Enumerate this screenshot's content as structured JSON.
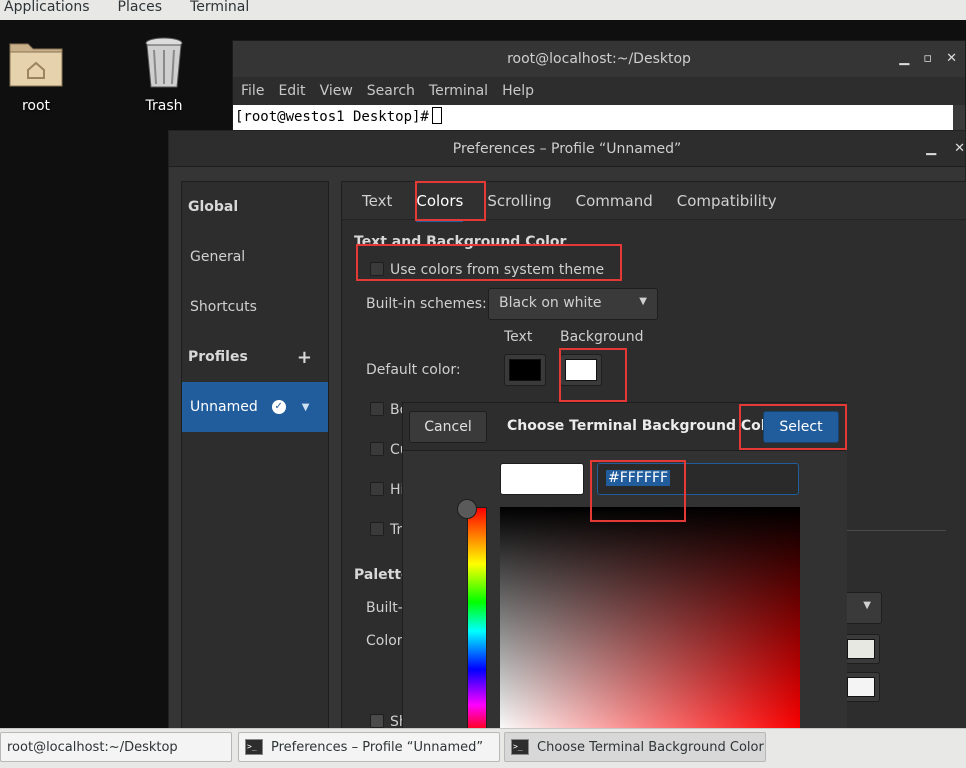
{
  "top_panel": {
    "menus": [
      "Applications",
      "Places",
      "Terminal"
    ]
  },
  "desktop": {
    "icons": [
      {
        "label": "root",
        "icon": "home-folder-icon"
      },
      {
        "label": "Trash",
        "icon": "trash-icon"
      }
    ]
  },
  "terminal": {
    "title": "root@localhost:~/Desktop",
    "menu": [
      "File",
      "Edit",
      "View",
      "Search",
      "Terminal",
      "Help"
    ],
    "prompt": "[root@westos1 Desktop]#"
  },
  "prefs": {
    "title": "Preferences – Profile “Unnamed”",
    "sidebar": {
      "global": "Global",
      "general": "General",
      "shortcuts": "Shortcuts",
      "profiles": "Profiles",
      "profile_item": "Unnamed"
    },
    "tabs": [
      "Text",
      "Colors",
      "Scrolling",
      "Command",
      "Compatibility"
    ],
    "active_tab": "Colors",
    "section_title": "Text and Background Color",
    "use_system_theme": "Use colors from system theme",
    "builtin_label": "Built-in schemes:",
    "builtin_value": "Black on white",
    "col_text": "Text",
    "col_background": "Background",
    "default_color_label": "Default color:",
    "text_color": "#000000",
    "bg_color": "#ffffff",
    "partial": {
      "bo": "Bo",
      "cu": "Cu",
      "hi": "Hi",
      "tr": "Tr",
      "palette": "Palette",
      "builtin2": "Built-i",
      "color": "Color",
      "sh": "Sh"
    }
  },
  "chooser": {
    "title": "Choose Terminal Background Color",
    "cancel": "Cancel",
    "select": "Select",
    "hex": "#FFFFFF"
  },
  "taskbar": {
    "items": [
      "root@localhost:~/Desktop",
      "Preferences – Profile “Unnamed”",
      "Choose Terminal Background Color"
    ]
  },
  "colors": {
    "accent": "#215d9c",
    "annotation": "#e53935"
  }
}
